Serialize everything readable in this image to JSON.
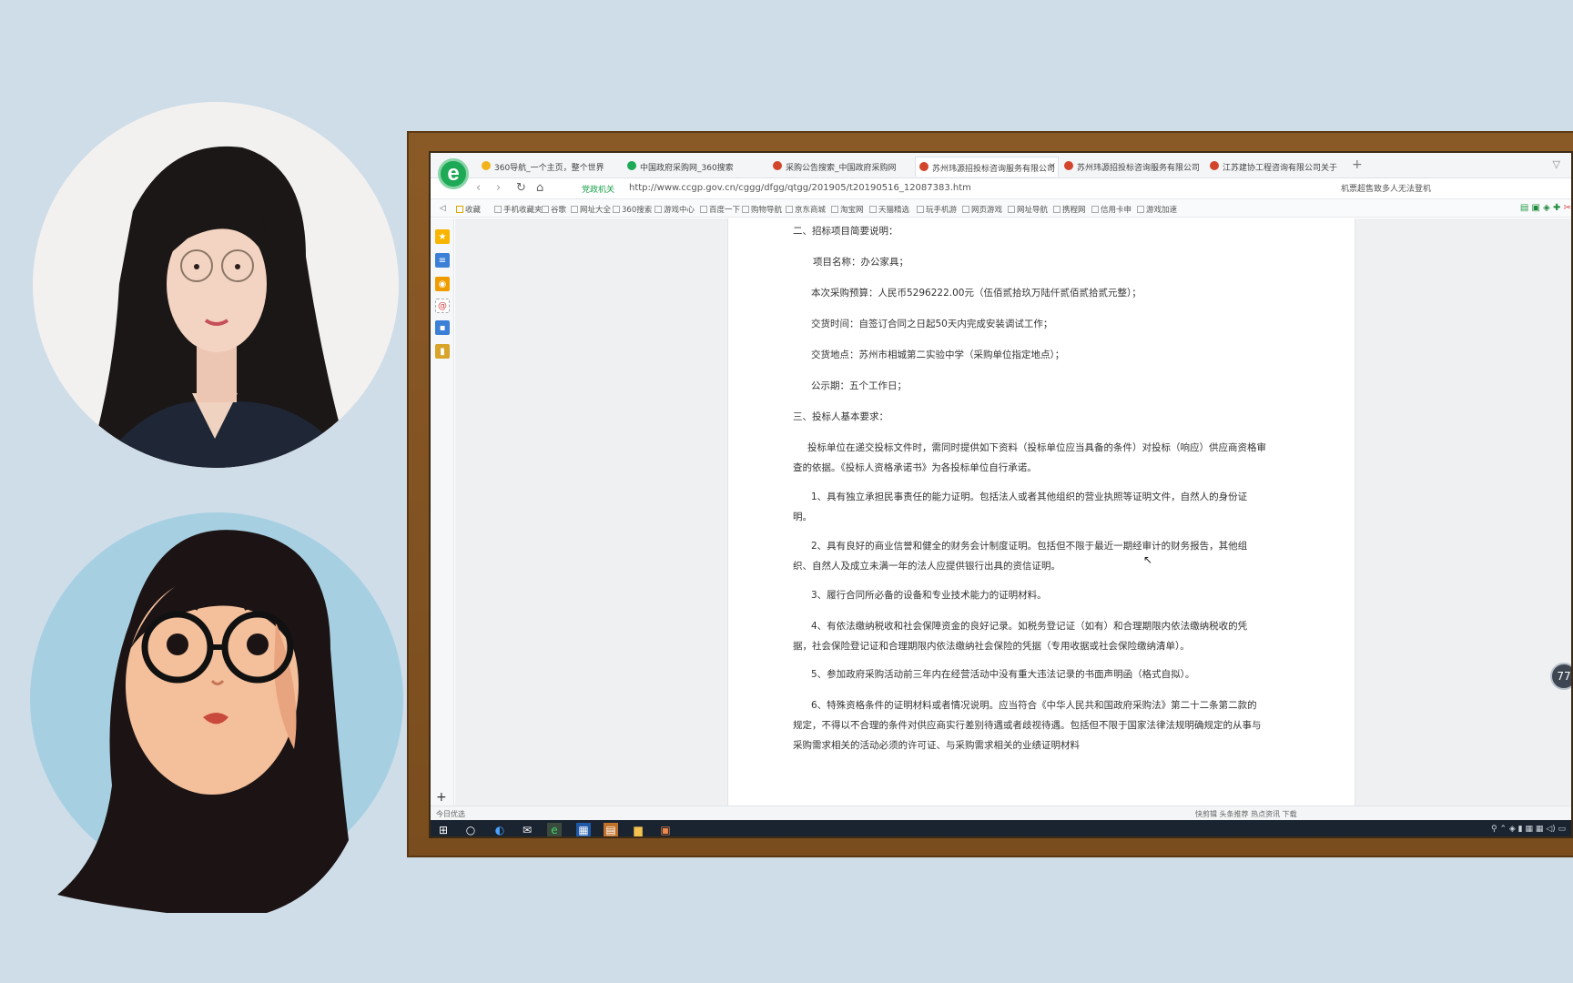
{
  "tabs": [
    {
      "label": "360导航_一个主页，整个世界",
      "icon_color": "#f2b21b",
      "active": false
    },
    {
      "label": "中国政府采购网_360搜索",
      "icon_color": "#1ea956",
      "active": false
    },
    {
      "label": "采购公告搜索_中国政府采购网",
      "icon_color": "#d2452b",
      "active": false
    },
    {
      "label": "苏州玮源招投标咨询服务有限公司",
      "icon_color": "#d2452b",
      "active": true
    },
    {
      "label": "苏州玮源招投标咨询服务有限公司",
      "icon_color": "#d2452b",
      "active": false
    },
    {
      "label": "江苏建协工程咨询有限公司关于",
      "icon_color": "#d2452b",
      "active": false
    }
  ],
  "tab_close": "×",
  "tab_add": "+",
  "address": {
    "secure_label": "党政机关",
    "url": "http://www.ccgp.gov.cn/cggg/dfgg/qtgg/201905/t20190516_12087383.htm",
    "right_text": "机票超售致多人无法登机"
  },
  "bookmarks": [
    "收藏",
    "手机收藏夹",
    "谷歌",
    "网址大全",
    "360搜索",
    "游戏中心",
    "百度一下",
    "购物导航",
    "京东商城",
    "淘宝网",
    "天猫精选",
    "玩手机游",
    "网页游戏",
    "网址导航",
    "携程网",
    "信用卡申",
    "游戏加速"
  ],
  "document": {
    "lines": [
      "二、招标项目简要说明：",
      "项目名称：办公家具；",
      "本次采购预算：人民币5296222.00元（伍佰贰拾玖万陆仟贰佰贰拾贰元整）；",
      "交货时间：自签订合同之日起50天内完成安装调试工作；",
      "交货地点：苏州市相城第二实验中学（采购单位指定地点）；",
      "公示期：五个工作日；",
      "三、投标人基本要求：",
      "投标单位在递交投标文件时，需同时提供如下资料（投标单位应当具备的条件）对投标（响应）供应商资格审查的依据。《投标人资格承诺书》为各投标单位自行承诺。",
      "1、具有独立承担民事责任的能力证明。包括法人或者其他组织的营业执照等证明文件，自然人的身份证明。",
      "2、具有良好的商业信誉和健全的财务会计制度证明。包括但不限于最近一期经审计的财务报告，其他组织、自然人及成立未满一年的法人应提供银行出具的资信证明。",
      "3、履行合同所必备的设备和专业技术能力的证明材料。",
      "4、有依法缴纳税收和社会保障资金的良好记录。如税务登记证（如有）和合理期限内依法缴纳税收的凭据，社会保险登记证和合理期限内依法缴纳社会保险的凭据（专用收据或社会保险缴纳清单）。",
      "5、参加政府采购活动前三年内在经营活动中没有重大违法记录的书面声明函（格式自拟）。",
      "6、特殊资格条件的证明材料或者情况说明。应当符合《中华人民共和国政府采购法》第二十二条第二款的规定，不得以不合理的条件对供应商实行差别待遇或者歧视待遇。包括但不限于国家法律法规明确规定的从事与采购需求相关的活动必须的许可证、与采购需求相关的业绩证明材料"
    ]
  },
  "statusbar": {
    "left": "今日优选",
    "right": "快剪辑   头条推荐   热点资讯        下载"
  },
  "float_badge": "77"
}
